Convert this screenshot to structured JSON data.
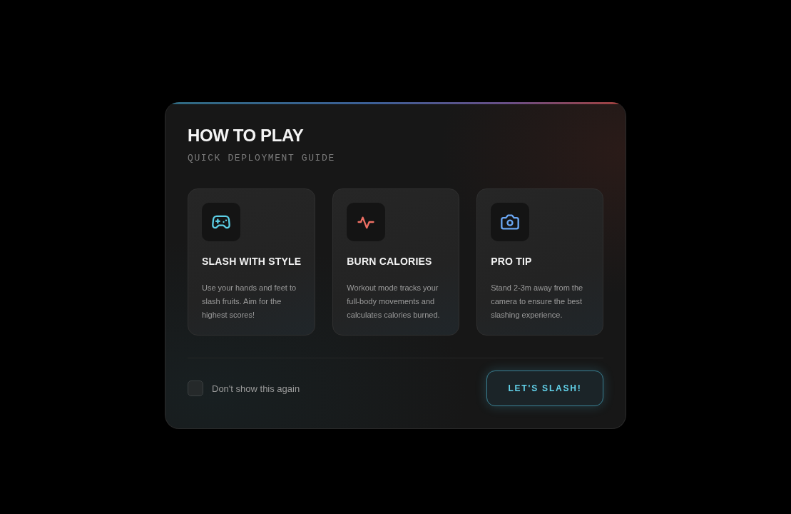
{
  "dialog": {
    "title": "HOW TO PLAY",
    "subtitle": "QUICK DEPLOYMENT GUIDE"
  },
  "cards": [
    {
      "title": "SLASH WITH STYLE",
      "text": "Use your hands and feet to slash fruits. Aim for the highest scores!"
    },
    {
      "title": "BURN CALORIES",
      "text": "Workout mode tracks your full-body movements and calculates calories burned."
    },
    {
      "title": "PRO TIP",
      "text": "Stand 2-3m away from the camera to ensure the best slashing experience."
    }
  ],
  "footer": {
    "checkbox": {
      "label": "Don't show this again",
      "checked": false
    },
    "button": "LET'S SLASH!"
  }
}
